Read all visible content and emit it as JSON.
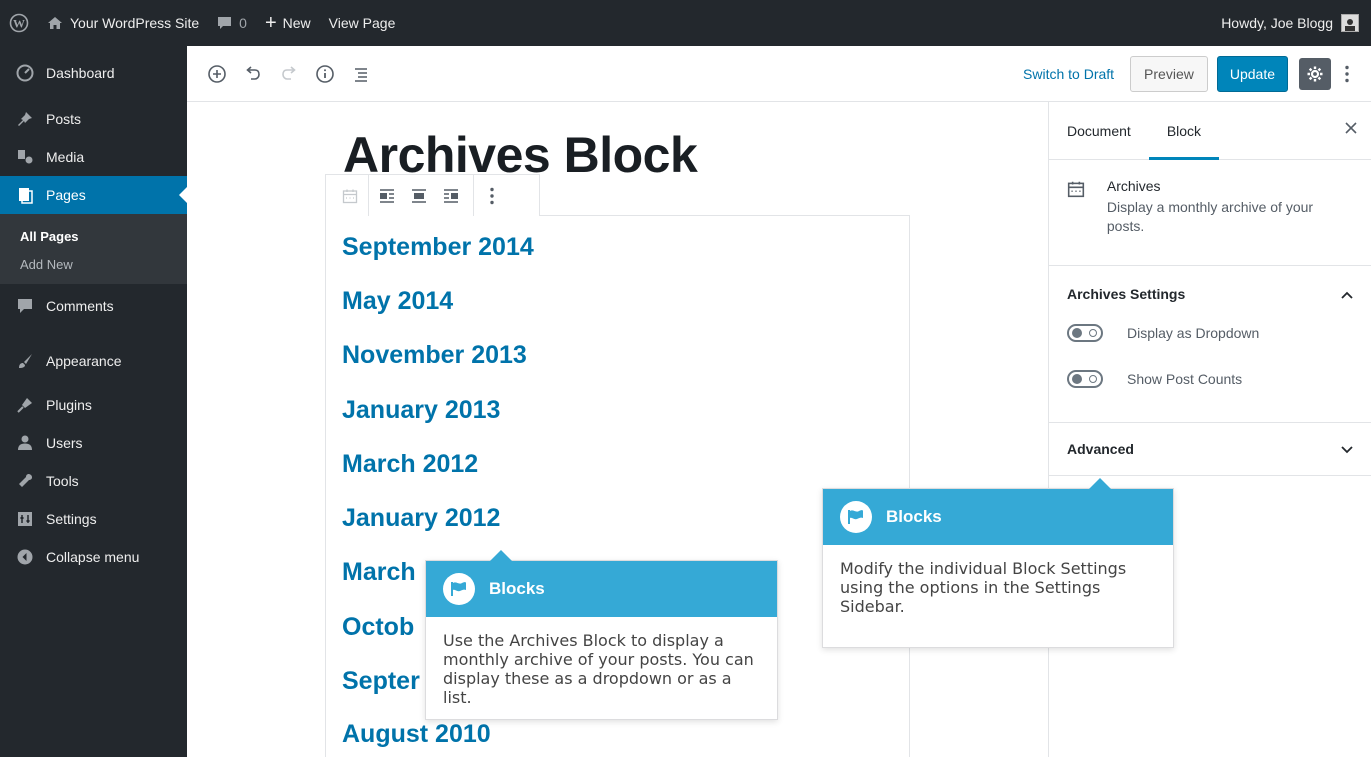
{
  "adminbar": {
    "site_name": "Your WordPress Site",
    "comments_count": "0",
    "new_label": "New",
    "view_page_label": "View Page",
    "howdy": "Howdy, Joe Blogg"
  },
  "menu": {
    "items": [
      {
        "label": "Dashboard",
        "icon": "dashboard-icon"
      },
      {
        "label": "Posts",
        "icon": "pin-icon"
      },
      {
        "label": "Media",
        "icon": "media-icon"
      },
      {
        "label": "Pages",
        "icon": "page-icon"
      },
      {
        "label": "Comments",
        "icon": "comment-icon"
      },
      {
        "label": "Appearance",
        "icon": "brush-icon"
      },
      {
        "label": "Plugins",
        "icon": "plug-icon"
      },
      {
        "label": "Users",
        "icon": "user-icon"
      },
      {
        "label": "Tools",
        "icon": "wrench-icon"
      },
      {
        "label": "Settings",
        "icon": "settings-icon"
      },
      {
        "label": "Collapse menu",
        "icon": "collapse-icon"
      }
    ],
    "submenu": [
      "All Pages",
      "Add New"
    ]
  },
  "header": {
    "switch_to_draft": "Switch to Draft",
    "preview": "Preview",
    "update": "Update"
  },
  "content": {
    "title": "Archives Block",
    "archives": [
      "September 2014",
      "May 2014",
      "November 2013",
      "January 2013",
      "March 2012",
      "January 2012",
      "March",
      "Octob",
      "Septer",
      "August 2010"
    ]
  },
  "sidebar": {
    "tabs": [
      "Document",
      "Block"
    ],
    "block_name": "Archives",
    "block_description": "Display a monthly archive of your posts.",
    "panel_settings": "Archives Settings",
    "toggle_dropdown": "Display as Dropdown",
    "toggle_counts": "Show Post Counts",
    "panel_advanced": "Advanced"
  },
  "popups": {
    "block": {
      "title": "Blocks",
      "body": "Use the Archives Block to display a monthly archive of your posts. You can display these as a dropdown or as a list."
    },
    "sidebar": {
      "title": "Blocks",
      "body": "Modify the individual Block Settings using the options in the Settings Sidebar."
    }
  },
  "colors": {
    "admin_dark": "#23282d",
    "accent": "#0073aa",
    "update_button": "#0085ba",
    "popup_header": "#35a9d6"
  }
}
